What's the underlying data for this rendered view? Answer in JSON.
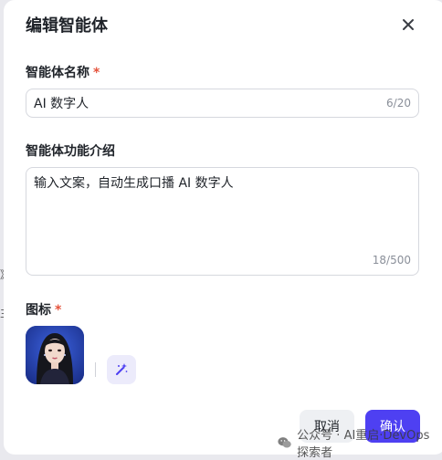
{
  "background": {
    "glyphs": [
      "》",
      "主"
    ]
  },
  "dialog": {
    "title": "编辑智能体",
    "close_icon": "close-icon"
  },
  "name_field": {
    "label": "智能体名称",
    "required_mark": "*",
    "value": "AI 数字人",
    "counter": "6/20"
  },
  "intro_field": {
    "label": "智能体功能介绍",
    "value": "输入文案，自动生成口播 AI 数字人",
    "counter": "18/500"
  },
  "icon_field": {
    "label": "图标",
    "required_mark": "*",
    "avatar": "avatar-image",
    "magic_icon": "sparkle-wand-icon"
  },
  "footer": {
    "cancel_label": "取消",
    "confirm_label": "确认"
  },
  "watermark": {
    "text": "公众号 · AI重启·DevOps 探索者",
    "icon": "wechat-icon"
  },
  "colors": {
    "accent": "#4e40f2",
    "required": "#e5533c",
    "magic_bg": "#ecebfb"
  }
}
